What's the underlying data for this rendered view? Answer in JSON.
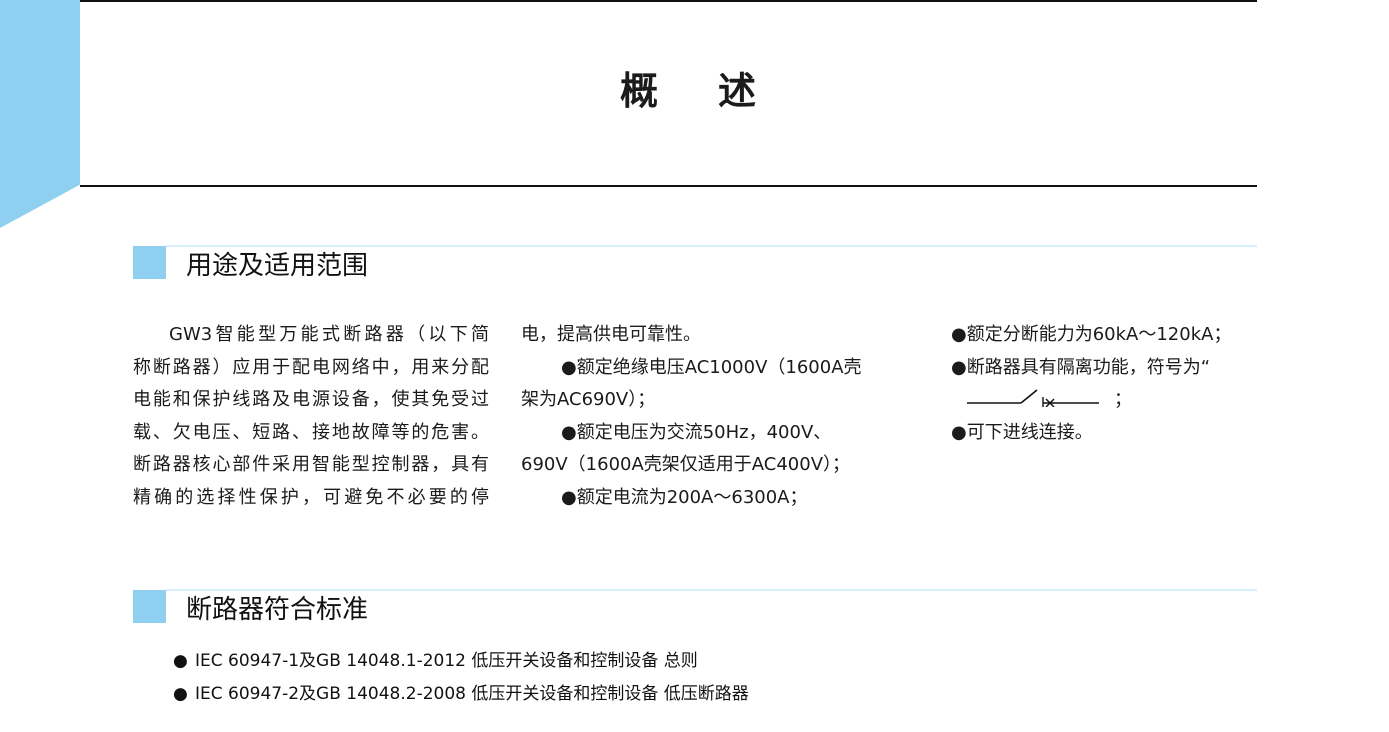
{
  "document": {
    "title": "概述",
    "sections": [
      {
        "title": "用途及适用范围",
        "column1": [
          "GW3智能型万能式断路器（以下简",
          "称断路器）应用于配电网络中，用来分配",
          "电能和保护线路及电源设备，使其免受过",
          "载、欠电压、短路、接地故障等的危害。",
          "断路器核心部件采用智能型控制器，具有",
          "精确的选择性保护，可避免不必要的停"
        ],
        "column2": [
          "电，提高供电可靠性。",
          "●额定绝缘电压AC1000V（1600A壳",
          "架为AC690V）；",
          "●额定电压为交流50Hz，400V、",
          "690V（1600A壳架仅适用于AC400V）；",
          "●额定电流为200A～6300A；"
        ],
        "column3": [
          "●额定分断能力为60kA～120kA；",
          "●断路器具有隔离功能，符号为“",
          "；",
          "●可下进线连接。"
        ]
      },
      {
        "title": "断路器符合标准",
        "items": [
          "IEC 60947-1及GB 14048.1-2012  低压开关设备和控制设备  总则",
          "IEC 60947-2及GB 14048.2-2008  低压开关设备和控制设备  低压断路器"
        ],
        "bullet": "●"
      }
    ]
  },
  "colors": {
    "accent": "#8fcff0",
    "section_line": "#d8eefb",
    "text": "#1b1b1b"
  },
  "icons": {
    "isolating_switch_symbol": "isolating-circuit-breaker-symbol"
  }
}
